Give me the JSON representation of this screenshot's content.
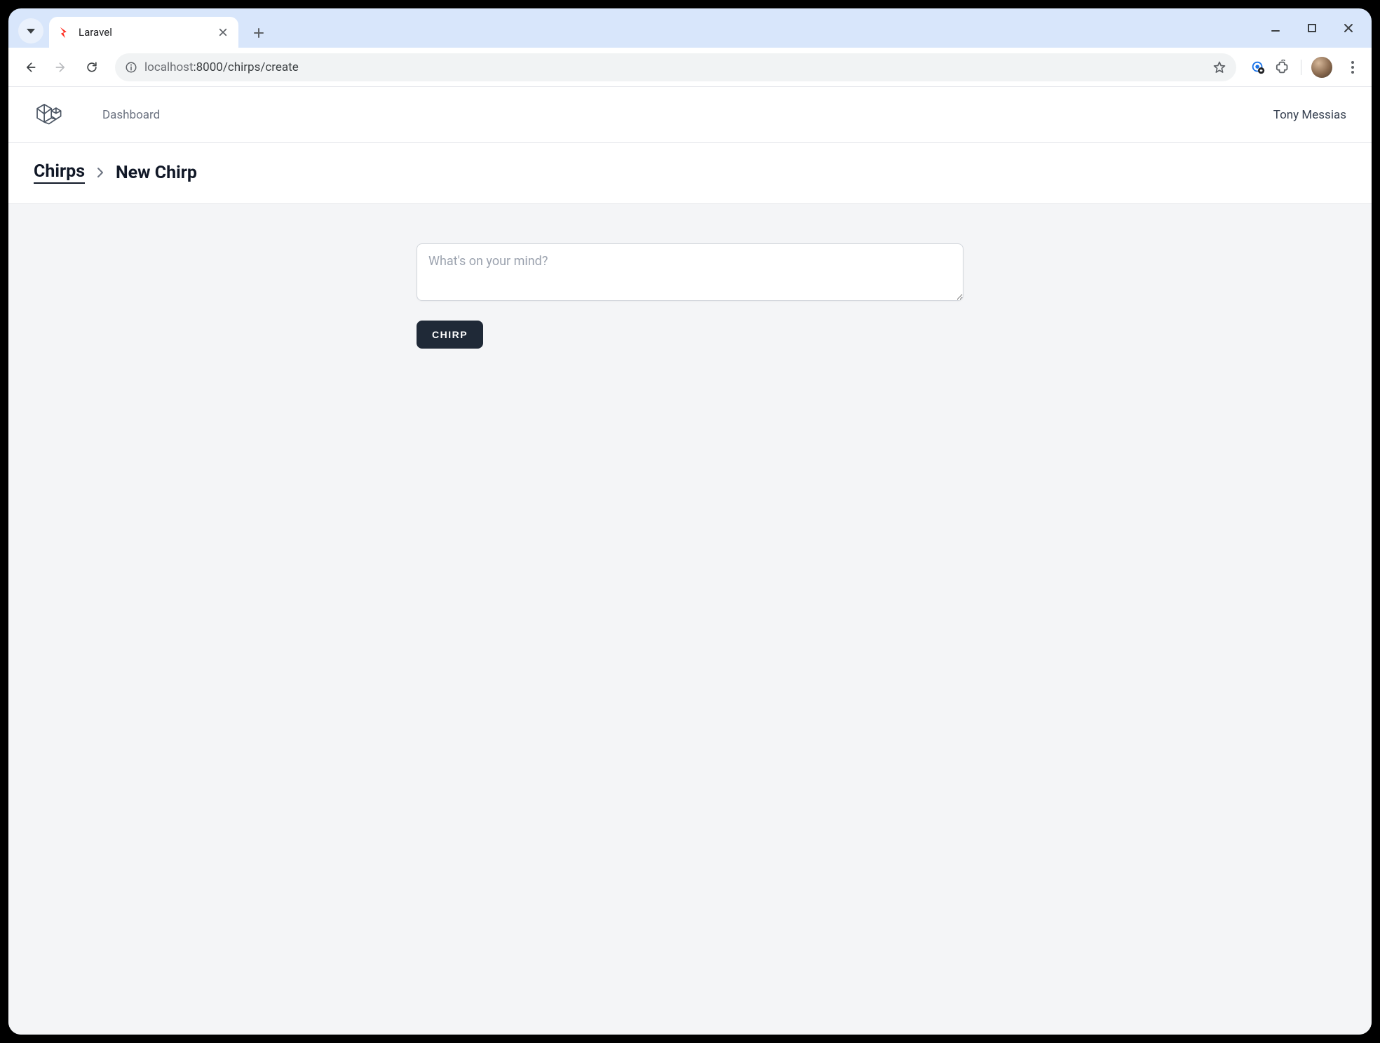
{
  "browser": {
    "tab_title": "Laravel",
    "url_host": "localhost",
    "url_port": ":8000",
    "url_path": "/chirps/create"
  },
  "nav": {
    "dashboard_label": "Dashboard",
    "user_name": "Tony Messias"
  },
  "breadcrumb": {
    "root": "Chirps",
    "current": "New Chirp"
  },
  "form": {
    "textarea_placeholder": "What's on your mind?",
    "textarea_value": "",
    "submit_label": "Chirp"
  }
}
